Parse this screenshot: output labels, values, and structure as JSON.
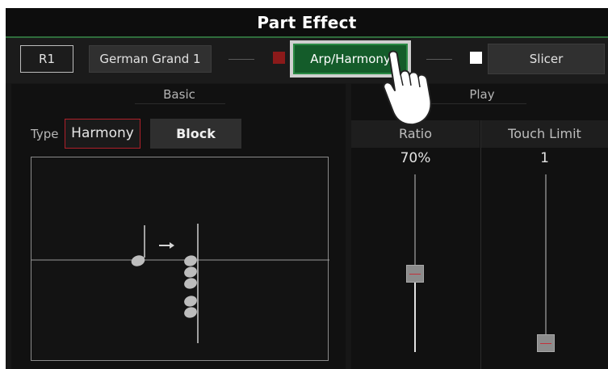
{
  "window": {
    "title": "Part Effect"
  },
  "toolbar": {
    "part": "R1",
    "voice": "German Grand 1",
    "arp_harmony": "Arp/Harmony",
    "slicer": "Slicer",
    "arp_indicator_color": "#8b1a1a",
    "slicer_indicator_color": "#ffffff"
  },
  "basic": {
    "heading": "Basic",
    "type_label": "Type",
    "type_value": "Harmony",
    "block_label": "Block"
  },
  "play": {
    "heading": "Play",
    "ratio": {
      "label": "Ratio",
      "value": "70%",
      "level": 0.7
    },
    "touch_limit": {
      "label": "Touch Limit",
      "value": "1",
      "level": 0.0
    }
  },
  "colors": {
    "accent_green": "#145c2a",
    "highlight_red": "#b0202a",
    "background": "#171717"
  },
  "icons": {
    "arrow": "right-arrow-icon",
    "pointer": "pointing-hand-icon"
  }
}
